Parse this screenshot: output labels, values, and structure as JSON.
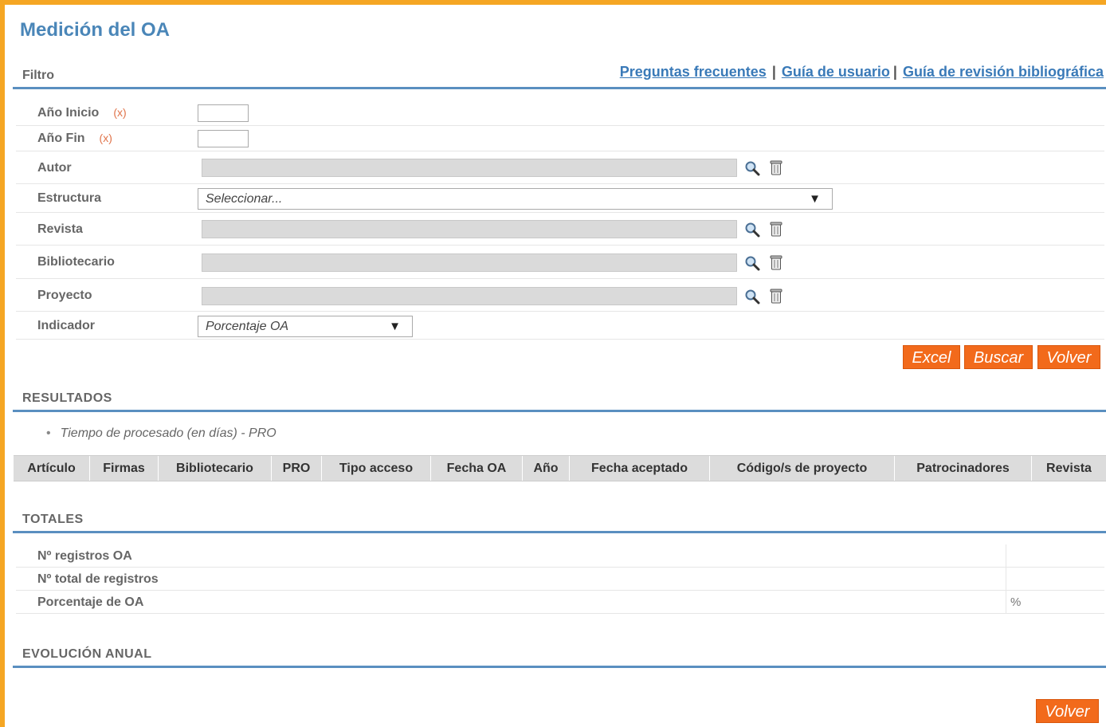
{
  "header": {
    "title": "Medición del OA"
  },
  "links": [
    {
      "label": "Preguntas frecuentes"
    },
    {
      "label": "Guía de usuario"
    },
    {
      "label": "Guía de revisión bibliográfica"
    }
  ],
  "separators": {
    "pipe": "|"
  },
  "filter": {
    "section_label": "Filtro",
    "required_mark": "(x)",
    "anio_inicio": {
      "label": "Año Inicio",
      "value": ""
    },
    "anio_fin": {
      "label": "Año Fin",
      "value": ""
    },
    "autor": {
      "label": "Autor",
      "value": ""
    },
    "estructura": {
      "label": "Estructura",
      "selected": "Seleccionar..."
    },
    "revista": {
      "label": "Revista",
      "value": ""
    },
    "bibliotecario": {
      "label": "Bibliotecario",
      "value": ""
    },
    "proyecto": {
      "label": "Proyecto",
      "value": ""
    },
    "indicador": {
      "label": "Indicador",
      "selected": "Porcentaje OA"
    }
  },
  "buttons": {
    "excel": "Excel",
    "buscar": "Buscar",
    "volver": "Volver"
  },
  "results": {
    "section_label": "RESULTADOS",
    "bullet": "Tiempo de procesado (en días) - PRO",
    "columns": [
      "Artículo",
      "Firmas",
      "Bibliotecario",
      "PRO",
      "Tipo acceso",
      "Fecha OA",
      "Año",
      "Fecha aceptado",
      "Código/s de proyecto",
      "Patrocinadores",
      "Revista"
    ]
  },
  "totals": {
    "section_label": "TOTALES",
    "registros_oa": {
      "label": "Nº registros OA",
      "value": ""
    },
    "total_registros": {
      "label": "Nº total de registros",
      "value": ""
    },
    "porcentaje": {
      "label": "Porcentaje de OA",
      "unit": "%"
    }
  },
  "evolution": {
    "section_label": "EVOLUCIÓN ANUAL"
  },
  "icons": {
    "search": "search-icon",
    "trash": "trash-icon",
    "dropdown": "chevron-down-icon"
  },
  "colors": {
    "accent": "#f5a623",
    "link": "#3a7ab8",
    "button": "#f26a1b",
    "section_line": "#5a8fc0"
  }
}
